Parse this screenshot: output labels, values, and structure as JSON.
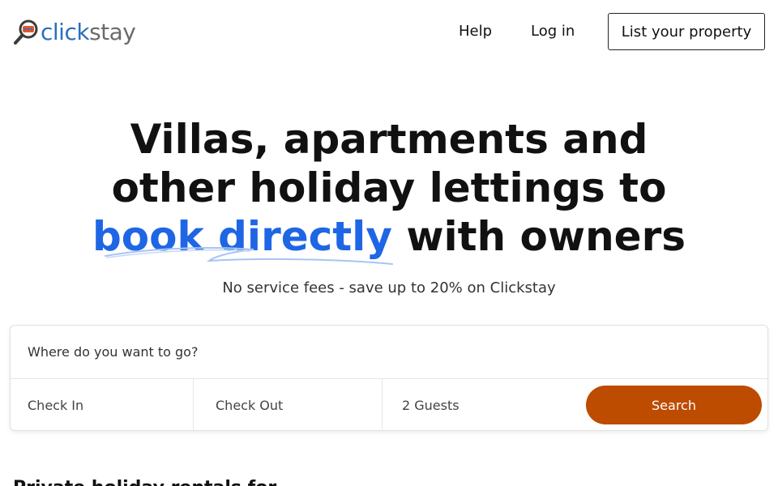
{
  "brand": {
    "name_part1": "click",
    "name_part2": "stay",
    "logo_icon": "search-chat-icon",
    "colors": {
      "blue": "#2a6fbf",
      "gray": "#6b6b6b",
      "orange": "#e8562a"
    }
  },
  "nav": {
    "help": "Help",
    "login": "Log in",
    "list_property": "List your property"
  },
  "hero": {
    "line1": "Villas, apartments and",
    "line2": "other holiday lettings to",
    "accent": "book directly",
    "line3_rest": " with owners",
    "subtitle": "No service fees - save up to 20% on Clickstay",
    "accent_color": "#1f66e5"
  },
  "search": {
    "where_placeholder": "Where do you want to go?",
    "check_in": "Check In",
    "check_out": "Check Out",
    "guests": "2 Guests",
    "button": "Search",
    "button_color": "#bd4b00"
  },
  "next_section": {
    "title": "Private holiday rentals for…"
  }
}
